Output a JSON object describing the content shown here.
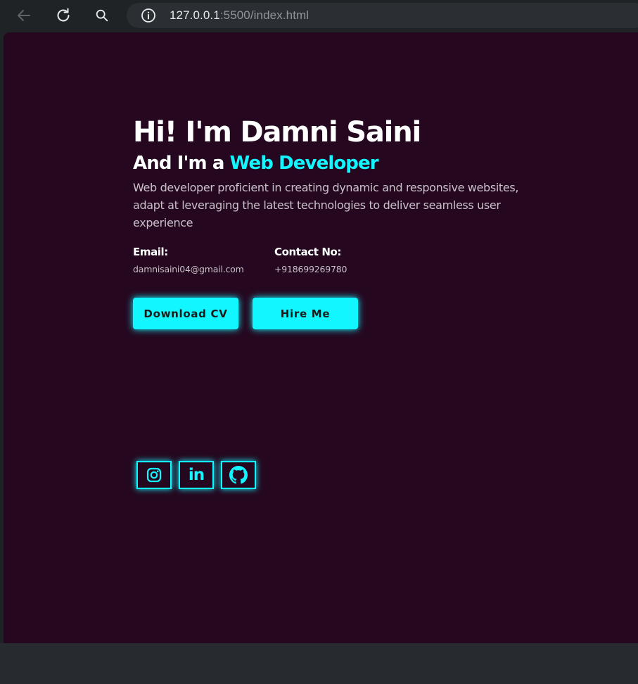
{
  "browser": {
    "url_host": "127.0.0.1",
    "url_rest": ":5500/index.html",
    "icons": {
      "back": "back-arrow-icon",
      "reload": "reload-icon",
      "search": "search-icon",
      "info": "info-icon"
    }
  },
  "hero": {
    "title": "Hi! I'm Damni Saini",
    "subtitle_prefix": "And I'm a ",
    "role": "Web Developer",
    "description": "Web developer proficient in creating dynamic and responsive websites, adapt at leveraging the latest technologies to deliver seamless user experience"
  },
  "contact": {
    "email_label": "Email:",
    "email_value": "damnisaini04@gmail.com",
    "phone_label": "Contact No:",
    "phone_value": "+918699269780"
  },
  "buttons": {
    "download_cv": "Download CV",
    "hire_me": "Hire Me"
  },
  "social": {
    "icons": [
      "instagram-icon",
      "linkedin-icon",
      "github-icon"
    ],
    "linkedin_text": "in"
  },
  "colors": {
    "page_background": "#250820",
    "accent": "#12f7ff",
    "browser_chrome": "#1f2326"
  }
}
